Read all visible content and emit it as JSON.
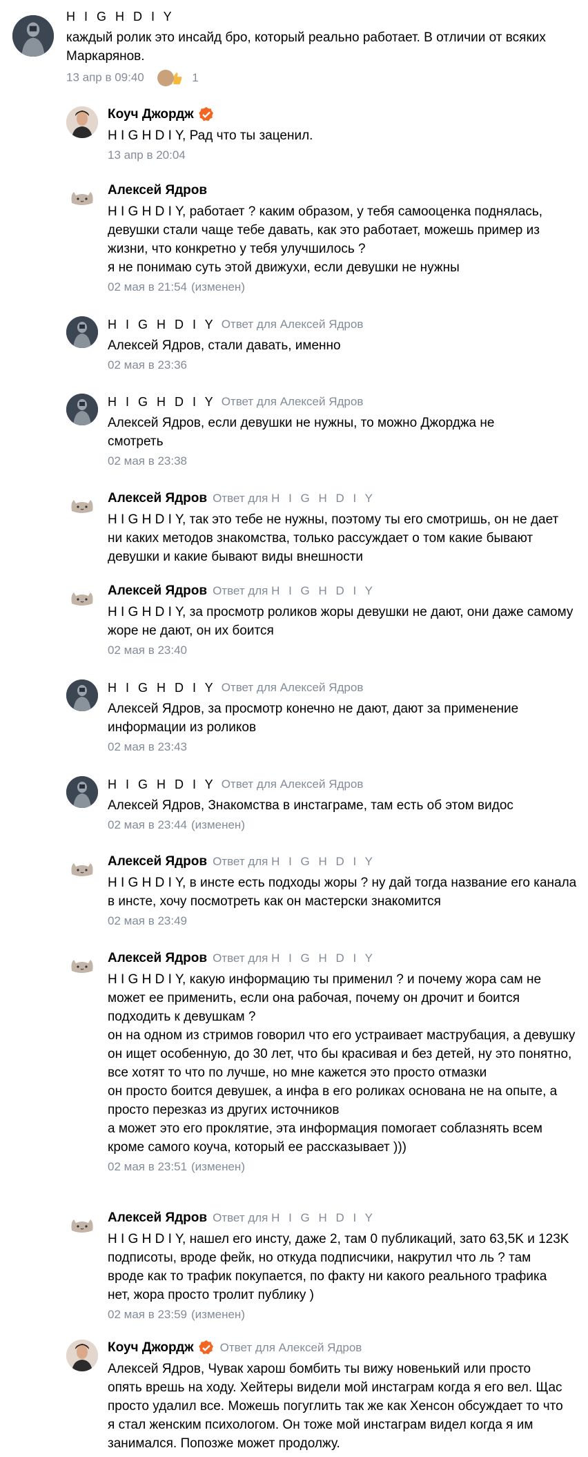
{
  "reply_prefix": "Ответ для",
  "comments": [
    {
      "author": "H I G H D I Y",
      "text": "каждый ролик это инсайд бро, который реально работает. В отличии от всяких Маркарянов.",
      "time": "13 апр в 09:40",
      "reactions_count": "1"
    },
    {
      "author": "Коуч Джордж",
      "text": "H I G H D I Y, Рад что ты заценил.",
      "time": "13 апр в 20:04"
    },
    {
      "author": "Алексей Ядров",
      "text": "H I G H D I Y, работает ? каким образом, у тебя самооценка поднялась, девушки стали чаще тебе давать, как это работает, можешь пример из жизни, что конкретно у тебя улучшилось ?\nя не понимаю суть этой движухи, если девушки не нужны",
      "time": "02 мая в 21:54",
      "edited": "(изменен)"
    },
    {
      "author": "H I G H D I Y",
      "reply_to": "Алексей Ядров",
      "text": "Алексей Ядров, стали давать, именно",
      "time": "02 мая в 23:36"
    },
    {
      "author": "H I G H D I Y",
      "reply_to": "Алексей Ядров",
      "text": "Алексей Ядров, если девушки не нужны, то можно Джорджа не смотреть",
      "time": "02 мая в 23:38"
    },
    {
      "author": "Алексей Ядров",
      "reply_to": "H I G H D I Y",
      "text": "H I G H D I Y, так это тебе не нужны, поэтому ты его смотришь, он не дает ни каких методов знакомства, только рассуждает о том какие бывают девушки и какие бывают виды внешности",
      "time": ""
    },
    {
      "author": "Алексей Ядров",
      "reply_to": "H I G H D I Y",
      "text": "H I G H D I Y, за просмотр роликов жоры девушки не дают, они даже самому жоре не дают, он их боится",
      "time": "02 мая в 23:40"
    },
    {
      "author": "H I G H D I Y",
      "reply_to": "Алексей Ядров",
      "text": "Алексей Ядров, за просмотр конечно не дают, дают за применение информации из роликов",
      "time": "02 мая в 23:43"
    },
    {
      "author": "H I G H D I Y",
      "reply_to": "Алексей Ядров",
      "text": "Алексей Ядров, Знакомства в инстаграме, там есть об этом видос",
      "time": "02 мая в 23:44",
      "edited": "(изменен)"
    },
    {
      "author": "Алексей Ядров",
      "reply_to": "H I G H D I Y",
      "text": "H I G H D I Y, в инсте есть подходы жоры ? ну дай тогда название его канала в инсте, хочу посмотреть как он мастерски знакомится",
      "time": "02 мая в 23:49"
    },
    {
      "author": "Алексей Ядров",
      "reply_to": "H I G H D I Y",
      "text": "H I G H D I Y, какую информацию ты применил ? и почему жора сам не может ее применить, если она рабочая, почему он дрочит и боится подходить к девушкам ?\nон на одном из стримов говорил что его устраивает маструбация, а девушку он ищет особенную, до 30 лет, что бы красивая и без детей, ну это понятно, все хотят то что по лучше, но мне кажется это просто отмазки\nон просто боится девушек, а инфа в его роликах основана не на опыте, а просто перезказ из других источников\nа может это его проклятие, эта информация помогает соблазнять всем кроме самого коуча, который ее рассказывает )))",
      "time": "02 мая в 23:51",
      "edited": "(изменен)"
    },
    {
      "author": "Алексей Ядров",
      "reply_to": "H I G H D I Y",
      "text": "H I G H D I Y, нашел его инсту, даже 2, там 0 публикаций, зато 63,5K и 123K подписоты, вроде фейк, но откуда подписчики, накрутил что ль ? там вроде как то трафик покупается, по факту ни какого реального трафика нет, жора просто тролит публику )",
      "time": "02 мая в 23:59",
      "edited": "(изменен)"
    },
    {
      "author": "Коуч Джордж",
      "reply_to": "Алексей Ядров",
      "text": "Алексей Ядров, Чувак харош бомбить ты вижу новенький или просто опять врешь на ходу. Хейтеры видели мой инстаграм когда я его вел. Щас просто удалил все. Можешь погуглить так же как Хенсон обсуждает то что я стал женским психологом. Он тоже мой инстаграм видел когда я им занимался. Попозже может продолжу.",
      "time": ""
    }
  ]
}
